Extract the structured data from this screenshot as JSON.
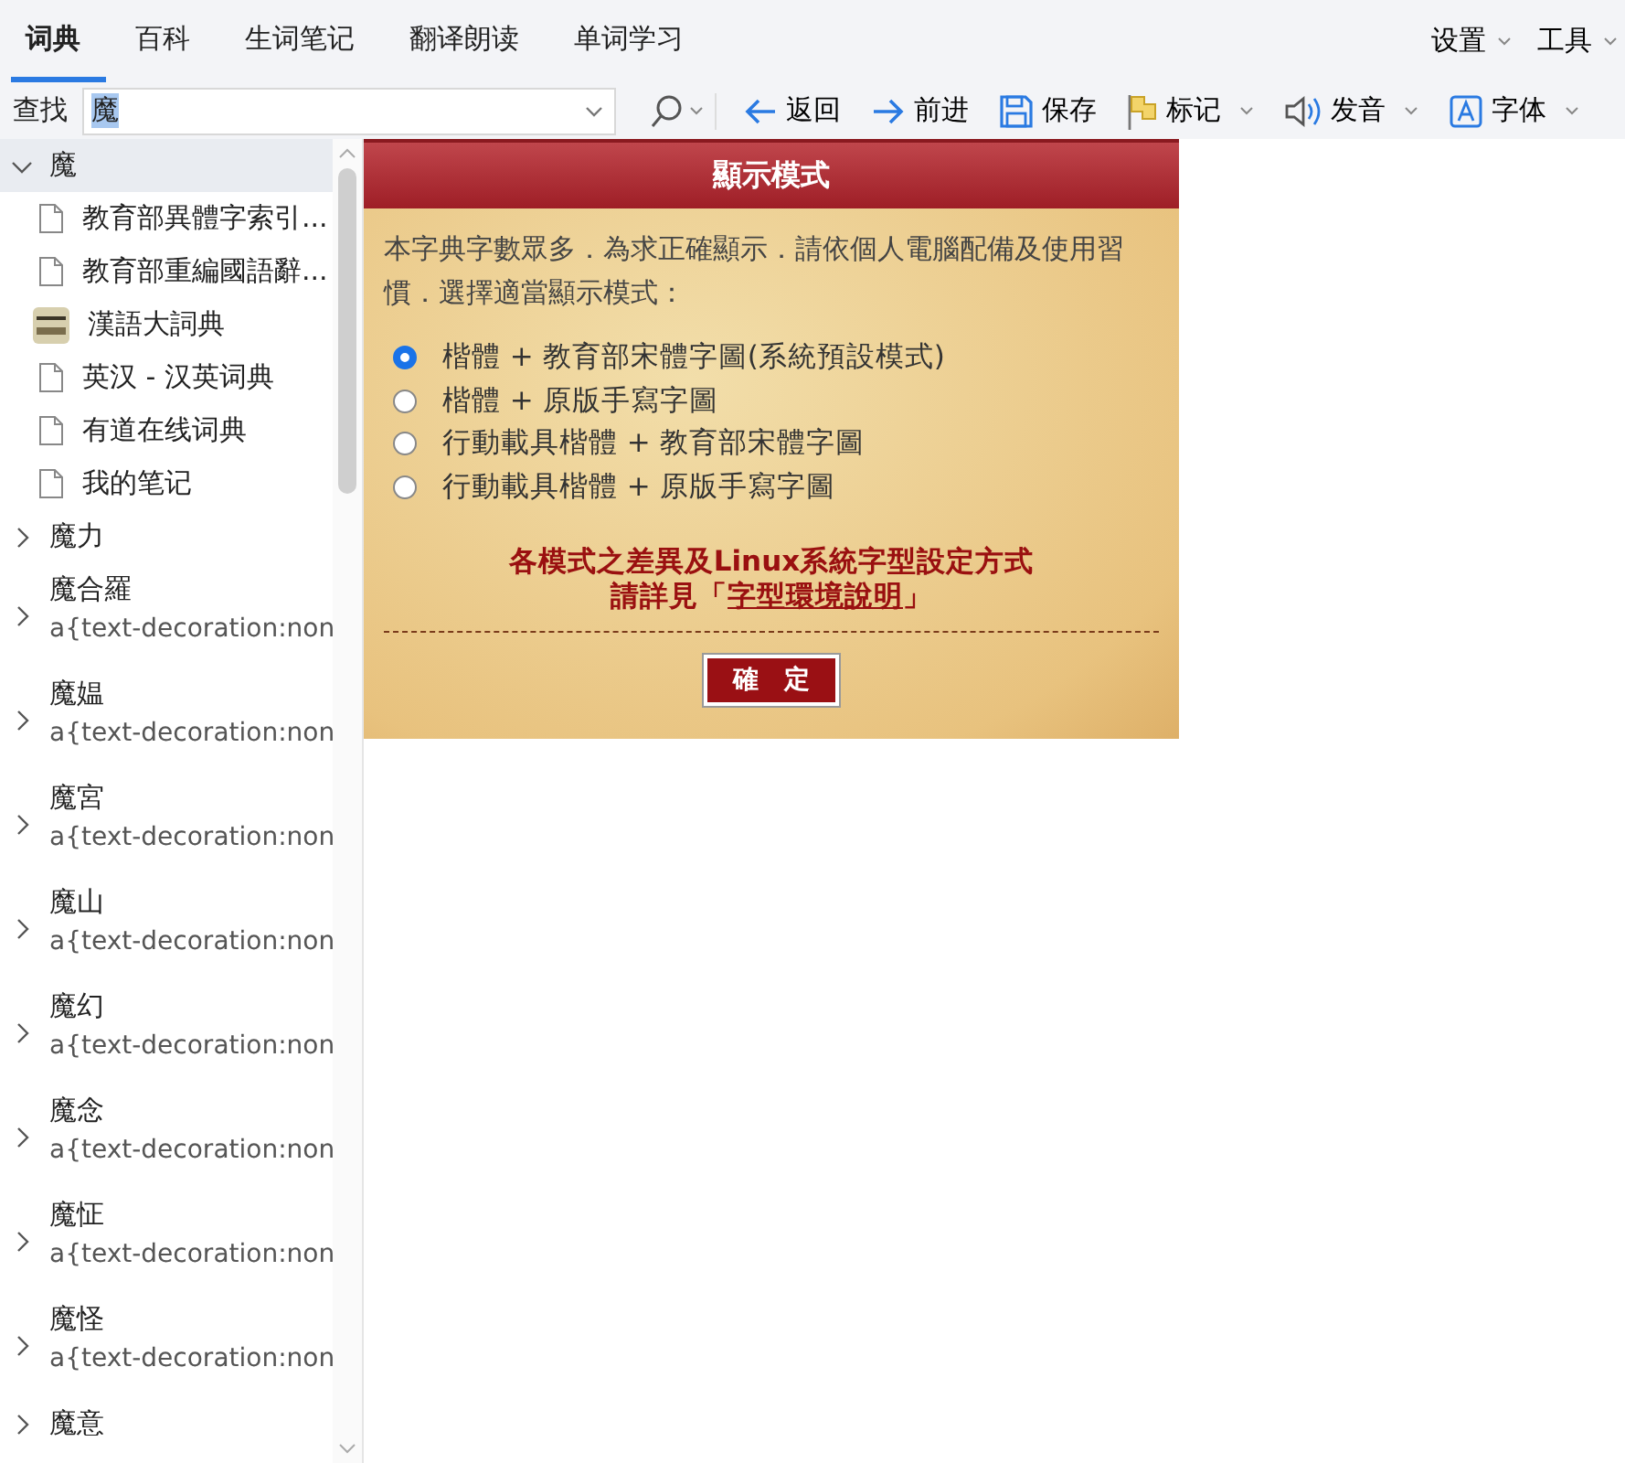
{
  "tabs": [
    {
      "label": "词典",
      "selected": true
    },
    {
      "label": "百科",
      "selected": false
    },
    {
      "label": "生词笔记",
      "selected": false
    },
    {
      "label": "翻译朗读",
      "selected": false
    },
    {
      "label": "单词学习",
      "selected": false
    }
  ],
  "menus": [
    {
      "label": "设置"
    },
    {
      "label": "工具"
    }
  ],
  "search": {
    "label": "查找",
    "value": "魔"
  },
  "toolbar": [
    {
      "label": "返回",
      "has_menu": false
    },
    {
      "label": "前进",
      "has_menu": false
    },
    {
      "label": "保存",
      "has_menu": false
    },
    {
      "label": "标记",
      "has_menu": true
    },
    {
      "label": "发音",
      "has_menu": true
    },
    {
      "label": "字体",
      "has_menu": true
    }
  ],
  "tree": [
    {
      "label": "魔",
      "expanded": true,
      "selected": true,
      "children": [
        {
          "label": "教育部異體字索引...",
          "kind": "doc"
        },
        {
          "label": "教育部重編國語辭...",
          "kind": "doc"
        },
        {
          "label": "漢語大詞典",
          "kind": "book"
        },
        {
          "label": "英汉 - 汉英词典",
          "kind": "doc"
        },
        {
          "label": "有道在线词典",
          "kind": "doc"
        },
        {
          "label": "我的笔记",
          "kind": "doc"
        }
      ]
    },
    {
      "label": "魔力",
      "expanded": false,
      "selected": false
    },
    {
      "label": "魔合羅",
      "subtitle": "a{text-decoration:non",
      "expanded": false,
      "selected": false
    },
    {
      "label": "魔媪",
      "subtitle": "a{text-decoration:non",
      "expanded": false,
      "selected": false
    },
    {
      "label": "魔宮",
      "subtitle": "a{text-decoration:non",
      "expanded": false,
      "selected": false
    },
    {
      "label": "魔山",
      "subtitle": "a{text-decoration:non",
      "expanded": false,
      "selected": false
    },
    {
      "label": "魔幻",
      "subtitle": "a{text-decoration:non",
      "expanded": false,
      "selected": false
    },
    {
      "label": "魔念",
      "subtitle": "a{text-decoration:non",
      "expanded": false,
      "selected": false
    },
    {
      "label": "魔怔",
      "subtitle": "a{text-decoration:non",
      "expanded": false,
      "selected": false
    },
    {
      "label": "魔怪",
      "subtitle": "a{text-decoration:non",
      "expanded": false,
      "selected": false
    },
    {
      "label": "魔意",
      "expanded": false,
      "selected": false
    }
  ],
  "dialog": {
    "title": "顯示模式",
    "intro": "本字典字數眾多．為求正確顯示．請依個人電腦配備及使用習慣．選擇適當顯示模式：",
    "options": [
      {
        "label": "楷體 + 教育部宋體字圖(系統預設模式)",
        "selected": true
      },
      {
        "label": "楷體 + 原版手寫字圖",
        "selected": false
      },
      {
        "label": "行動載具楷體 + 教育部宋體字圖",
        "selected": false
      },
      {
        "label": "行動載具楷體 + 原版手寫字圖",
        "selected": false
      }
    ],
    "note": "各模式之差異及Linux系統字型設定方式",
    "note_prefix": "請詳見「",
    "link": "字型環境說明",
    "note_suffix": "」",
    "button": "確　定"
  }
}
